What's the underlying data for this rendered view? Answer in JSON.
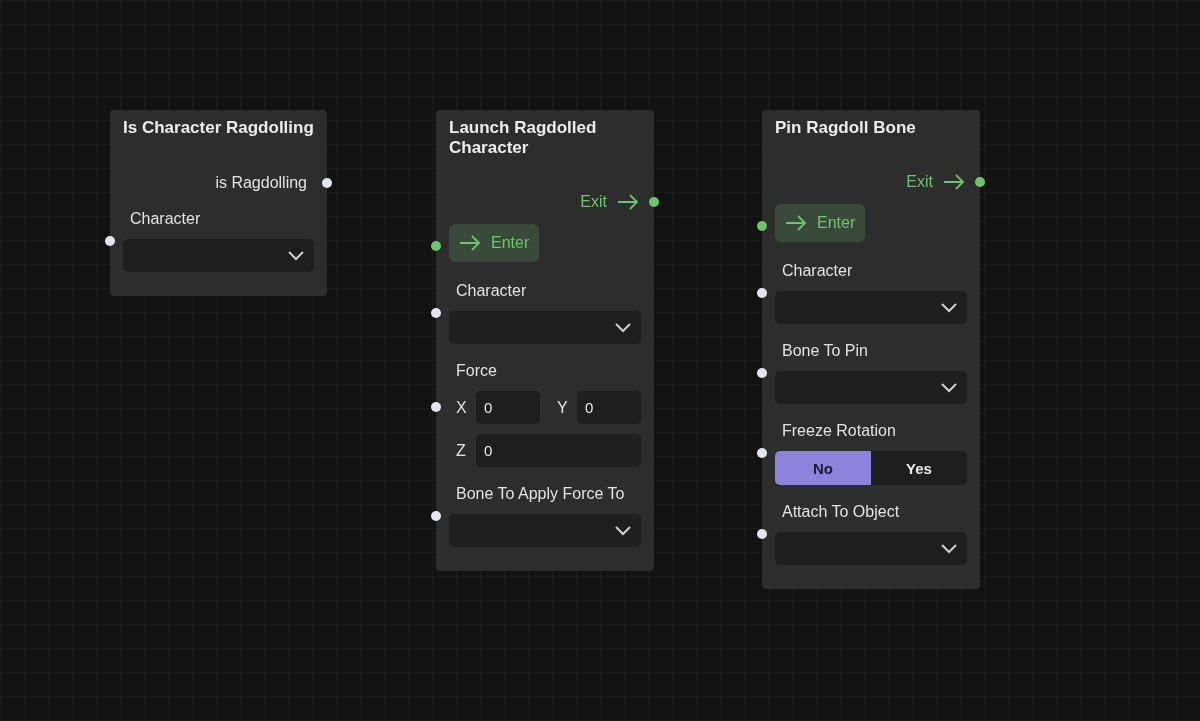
{
  "nodes": [
    {
      "title": "Is Character Ragdolling",
      "rows": [
        {
          "kind": "output",
          "label": "is Ragdolling"
        },
        {
          "kind": "select",
          "label": "Character"
        }
      ]
    },
    {
      "title": "Launch Ragdolled Character",
      "rows": [
        {
          "kind": "exec_out",
          "label": "Exit"
        },
        {
          "kind": "exec_in",
          "label": "Enter"
        },
        {
          "kind": "select",
          "label": "Character"
        },
        {
          "kind": "vector",
          "label": "Force",
          "fields": [
            {
              "axis": "X",
              "value": "0"
            },
            {
              "axis": "Y",
              "value": "0"
            },
            {
              "axis": "Z",
              "value": "0"
            }
          ]
        },
        {
          "kind": "select",
          "label": "Bone To Apply Force To"
        }
      ]
    },
    {
      "title": "Pin Ragdoll Bone",
      "rows": [
        {
          "kind": "exec_out",
          "label": "Exit"
        },
        {
          "kind": "exec_in",
          "label": "Enter"
        },
        {
          "kind": "select",
          "label": "Character"
        },
        {
          "kind": "select",
          "label": "Bone To Pin"
        },
        {
          "kind": "toggle",
          "label": "Freeze Rotation",
          "options": [
            {
              "label": "No",
              "selected": true
            },
            {
              "label": "Yes",
              "selected": false
            }
          ]
        },
        {
          "kind": "select",
          "label": "Attach To Object"
        }
      ]
    }
  ]
}
